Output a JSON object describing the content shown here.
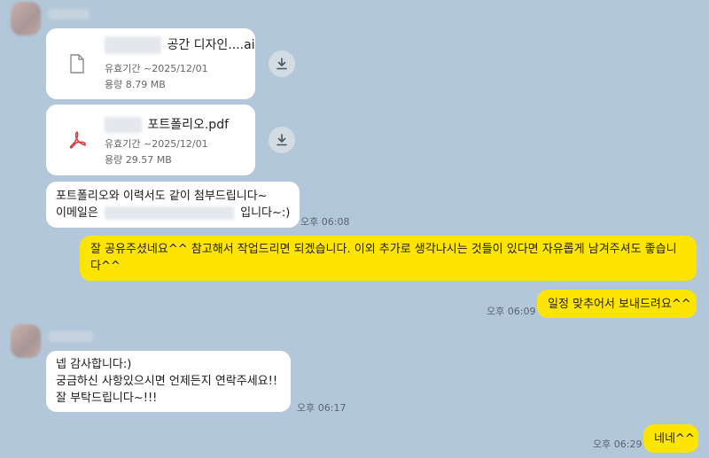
{
  "files": [
    {
      "name": "공간 디자인....ai",
      "expiry": "유효기간 ~2025/12/01",
      "size": "용량 8.79 MB",
      "icon": "document-icon"
    },
    {
      "name": "포트폴리오.pdf",
      "expiry": "유효기간 ~2025/12/01",
      "size": "용량 29.57 MB",
      "icon": "pdf-icon"
    }
  ],
  "messages": {
    "m1": {
      "line1": "포트폴리오와 이력서도 같이 첨부드립니다~",
      "line2_pre": "이메일은",
      "line2_post": "입니다~:)",
      "time": "오후 06:08"
    },
    "m2": {
      "line1": "잘 공유주셨네요^^ 참고해서 작업드리면 되겠습니다. 이외 추가로 생각나시는 것들이 있다면 자유롭게 남겨주셔도 좋습니",
      "line2": "다^^"
    },
    "m3": {
      "text": "일정 맞추어서 보내드려요^^",
      "time": "오후 06:09"
    },
    "m4": {
      "line1": "넵 감사합니다:)",
      "line2": "궁금하신 사항있으시면 언제든지 연락주세요!!",
      "line3": "잘 부탁드립니다~!!!",
      "time": "오후 06:17"
    },
    "m5": {
      "text": "네네^^",
      "time": "오후 06:29"
    }
  },
  "colors": {
    "background": "#b2c7da",
    "my_bubble": "#fee500",
    "their_bubble": "#ffffff",
    "pdf_icon": "#e0323a"
  }
}
